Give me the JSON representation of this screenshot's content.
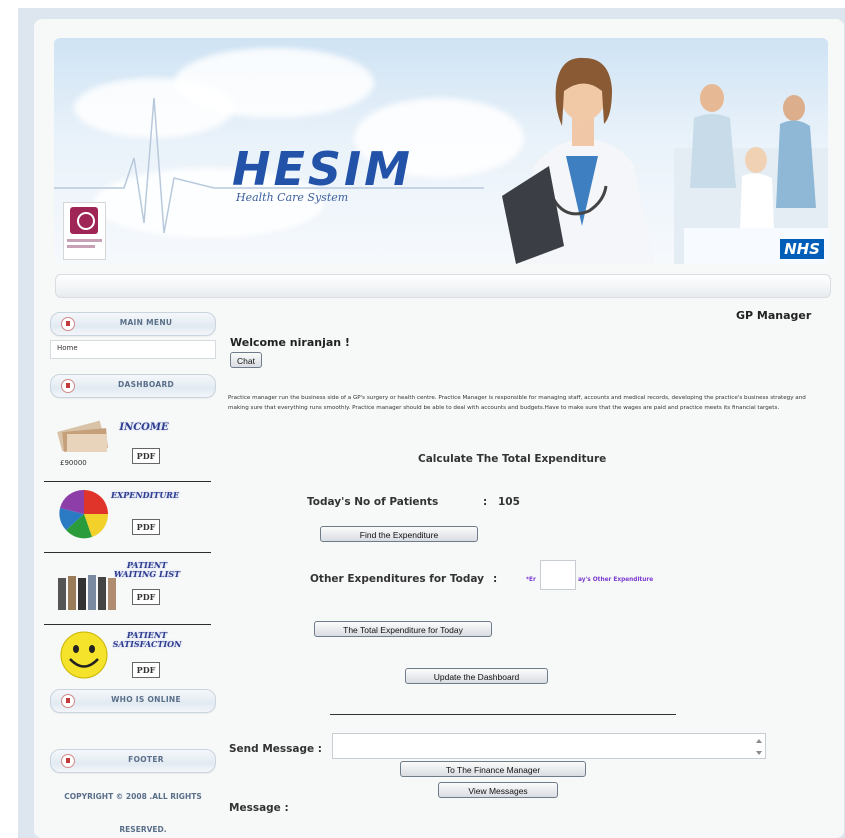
{
  "banner": {
    "title": "HESIM",
    "subtitle": "Health Care System",
    "badge": "NHS"
  },
  "sidebar": {
    "main_menu": "MAIN MENU",
    "home": "Home",
    "dashboard": "DASHBOARD",
    "income": {
      "title": "INCOME",
      "amount": "£90000"
    },
    "expenditure": {
      "title": "EXPENDITURE"
    },
    "patient_waiting": {
      "title_line1": "PATIENT",
      "title_line2": "WAITING LIST"
    },
    "patient_satisfaction": {
      "title_line1": "PATIENT",
      "title_line2": "SATISFACTION"
    },
    "pdf_label": "PDF",
    "who_is_online": "WHO IS ONLINE",
    "footer": "FOOTER",
    "copyright_line1": "COPYRIGHT © 2008 .ALL RIGHTS",
    "copyright_line2": "RESERVED."
  },
  "main": {
    "role": "GP Manager",
    "welcome": "Welcome niranjan !",
    "chat_button": "Chat",
    "description": "Practice manager run the business side of a GP's surgery or health centre. Practice Manager is responsible for managing staff, accounts and medical records, developing the practice's business strategy and making sure that everything runs smoothly. Practice manager should be able to deal with accounts and budgets.Have to make sure that the wages are paid and practice meets its financial targets.",
    "calc_heading": "Calculate The Total Expenditure",
    "patients_label": "Today's No of Patients",
    "patients_sep": ":",
    "patients_value": "105",
    "find_button": "Find the Expenditure",
    "other_label": "Other Expenditures for Today",
    "other_sep": ":",
    "other_hint_left": "*Er",
    "other_hint_right": "ay's Other Expenditure",
    "total_button": "The Total Expenditure for Today",
    "update_button": "Update the Dashboard",
    "send_label": "Send Message :",
    "finance_button": "To The Finance Manager",
    "view_button": "View Messages",
    "message_label": "Message :"
  }
}
